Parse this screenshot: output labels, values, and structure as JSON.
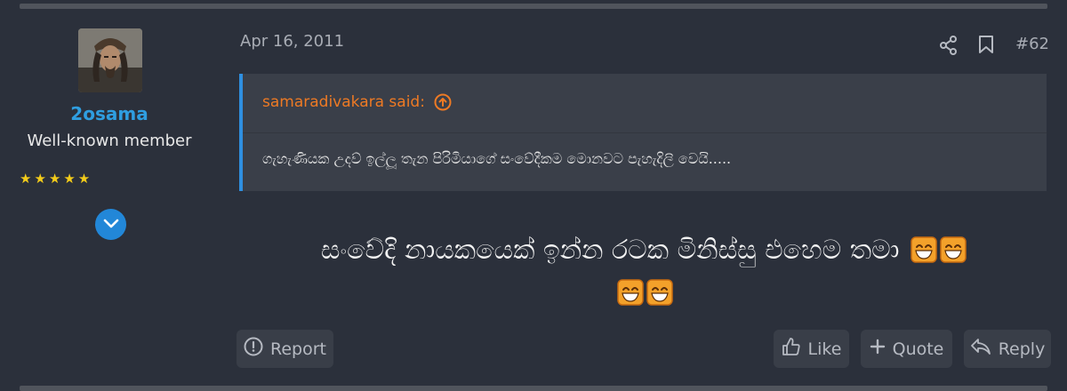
{
  "post": {
    "date": "Apr 16, 2011",
    "number": "#62",
    "message": "සංවේදි නායකයෙක් ඉන්න රටක මිනිස්සු එහෙම තමා"
  },
  "user": {
    "name": "2osama",
    "title": "Well-known member",
    "stars": "★★★★★",
    "rating": 5
  },
  "quote": {
    "author": "samaradivakara said:",
    "text": "ගැහැණියක උදව් ඉල්ලූ තැන පිරිමියාගේ සංවේදීකම මොනවට පැහැදිලි වෙයි....."
  },
  "actions": {
    "report": "Report",
    "like": "Like",
    "quote": "Quote",
    "reply": "Reply"
  },
  "icons": {
    "share": "share-icon",
    "bookmark": "bookmark-icon",
    "expand": "chevron-down-icon",
    "emoji": "grinning-face-emoji"
  },
  "colors": {
    "background": "#2b303b",
    "username": "#2f9ee0",
    "quote_author": "#ee7a24",
    "quote_border": "#2f8fe0",
    "stars": "#f4cc1a"
  }
}
